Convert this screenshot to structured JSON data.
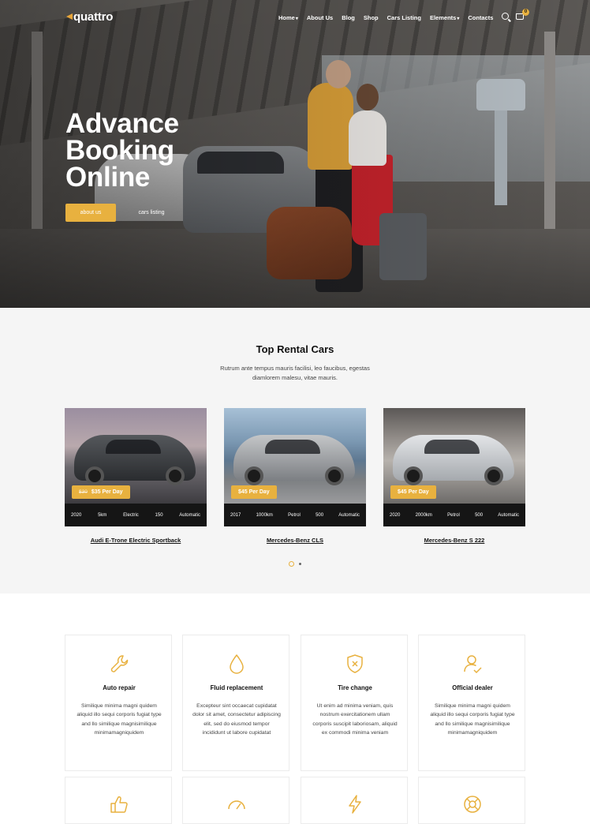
{
  "header": {
    "logo_text": "quattro",
    "menu": [
      "Home",
      "About Us",
      "Blog",
      "Shop",
      "Cars Listing",
      "Elements",
      "Contacts"
    ],
    "cart_count": "0",
    "accent_color": "#e8b13f"
  },
  "hero": {
    "title_line1": "Advance",
    "title_line2": "Booking",
    "title_line3": "Online",
    "primary_button": "about us",
    "secondary_button": "cars listing"
  },
  "rental": {
    "title": "Top Rental Cars",
    "subtitle": "Rutrum ante tempus mauris facilisi, leo faucibus, egestas diamlorem malesu, vitae mauris.",
    "cars": [
      {
        "name": "Audi E-Trone Electric Sportback",
        "old_price": "$30",
        "price": "$35 Per Day",
        "specs": [
          "2020",
          "5km",
          "Electric",
          "150",
          "Automatic"
        ]
      },
      {
        "name": "Mercedes-Benz CLS",
        "old_price": "",
        "price": "$45 Per Day",
        "specs": [
          "2017",
          "1000km",
          "Petrol",
          "500",
          "Automatic"
        ]
      },
      {
        "name": "Mercedes-Benz S 222",
        "old_price": "",
        "price": "$45 Per Day",
        "specs": [
          "2020",
          "2000km",
          "Petrol",
          "500",
          "Automatic"
        ]
      }
    ]
  },
  "services": [
    {
      "icon": "wrench-icon",
      "title": "Auto repair",
      "text": "Similique minima magni quidem aliquid illo sequi corporis fugiat type and llo similique magnisimilique minimamagniquidem"
    },
    {
      "icon": "drop-icon",
      "title": "Fluid replacement",
      "text": "Excepteur sint occaecat cupidatat dolor sit amet, consectetur adipiscing elit, sed do eiusmod tempor incididunt ut labore cupidatat"
    },
    {
      "icon": "shield-icon",
      "title": "Tire change",
      "text": "Ut enim ad minima veniam, quis nostrum exercitationem ullam corporis suscipit laboriosam, aliquid ex commodi minima veniam"
    },
    {
      "icon": "user-check-icon",
      "title": "Official dealer",
      "text": "Similique minima magni quidem aliquid illo sequi corporis fugiat type and llo similique magnisimilique minimamagniquidem"
    }
  ],
  "services_row2_icons": [
    "thumbs-up-icon",
    "speedometer-icon",
    "lightning-icon",
    "lifebuoy-icon"
  ]
}
